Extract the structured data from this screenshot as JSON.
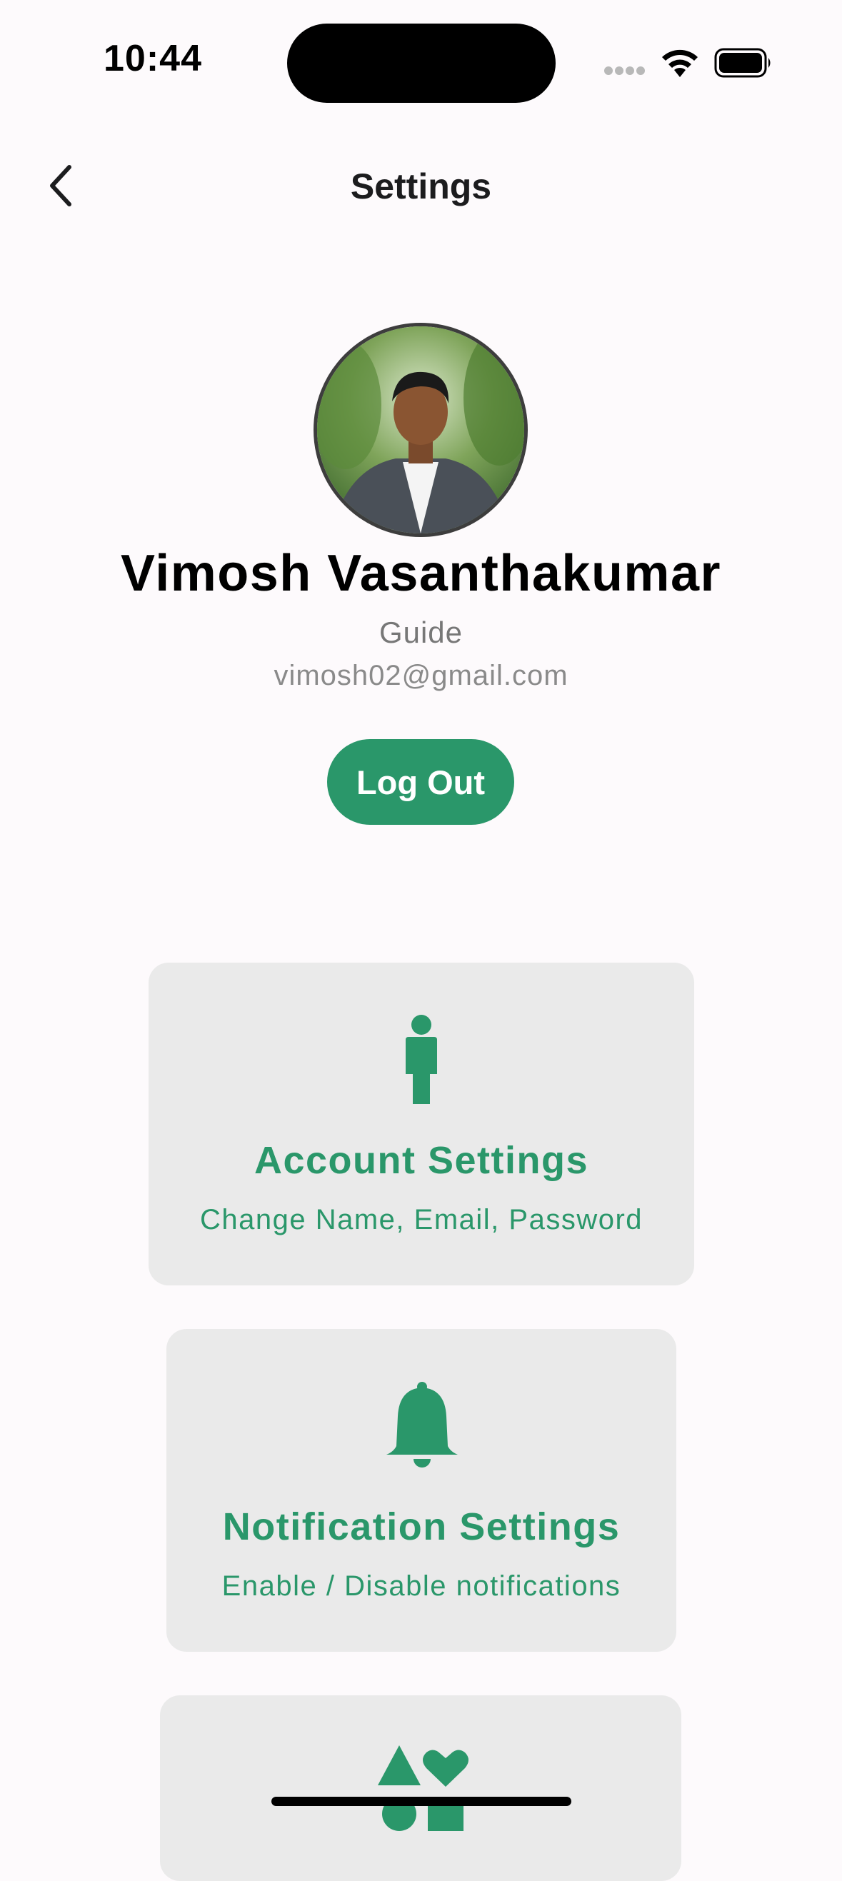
{
  "status_bar": {
    "time": "10:44"
  },
  "header": {
    "title": "Settings",
    "back_icon": "chevron-left-icon"
  },
  "profile": {
    "name": "Vimosh Vasanthakumar",
    "role": "Guide",
    "email": "vimosh02@gmail.com",
    "logout_label": "Log Out"
  },
  "cards": [
    {
      "title": "Account Settings",
      "subtitle": "Change Name, Email, Password",
      "icon": "person-icon"
    },
    {
      "title": "Notification Settings",
      "subtitle": "Enable / Disable notifications",
      "icon": "bell-icon"
    },
    {
      "title": "",
      "subtitle": "",
      "icon": "shapes-icon"
    }
  ],
  "colors": {
    "accent": "#2a976a",
    "card_bg": "#eaeaea",
    "background": "#fdfafc"
  }
}
